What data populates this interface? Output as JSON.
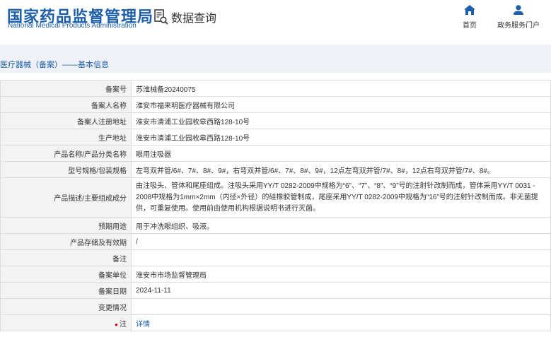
{
  "header": {
    "logo_cn": "国家药品监督管理局",
    "logo_en": "National Medical Products Administration",
    "db_label": "数据查询",
    "nav_home": "首页",
    "nav_gov": "政务服务门户"
  },
  "breadcrumb": "医疗器械（备案）——基本信息",
  "rows": [
    {
      "label": "备案号",
      "value": "苏淮械备20240075"
    },
    {
      "label": "备案人名称",
      "value": "淮安市福来明医疗器械有限公司"
    },
    {
      "label": "备案人注册地址",
      "value": "淮安市清浦工业园枚皋西路128-10号"
    },
    {
      "label": "生产地址",
      "value": "淮安市清浦工业园枚皋西路128-10号"
    },
    {
      "label": "产品名称/产品分类名称",
      "value": "眼用注吸器"
    },
    {
      "label": "型号规格/包装规格",
      "value": "左弯双并管/6#、7#、8#、9#，右弯双并管/6#、7#、8#、9#，12点左弯双并管/7#、8#，12点右弯双并管/7#、8#。"
    },
    {
      "label": "产品描述/主要组成成分",
      "value": "由注吸头、管体和尾座组成。注吸头采用YY/T 0282-2009中规格为“6”、“7”、“8”、“9”号的注射针改制而成，管体采用YY/T 0031 - 2008中规格为1mm×2mm（内径×外径）的硅橡胶管制成，尾座采用YY/T 0282-2009中规格为“16”号的注射针改制而成。非无菌提供，可重复使用。使用前由使用机构根据说明书进行灭菌。"
    },
    {
      "label": "预期用途",
      "value": "用于冲洗眼组织、吸液。"
    },
    {
      "label": "产品存储及有效期",
      "value": "/"
    },
    {
      "label": "备注",
      "value": ""
    },
    {
      "label": "备案单位",
      "value": "淮安市市场监督管理局"
    },
    {
      "label": "备案日期",
      "value": "2024-11-11"
    },
    {
      "label": "变更情况",
      "value": ""
    },
    {
      "label": "注",
      "value": "详情"
    }
  ],
  "colors": {
    "brand": "#1c5fa8",
    "label_bg": "#f3f3f3",
    "band": "#eef1f5"
  }
}
